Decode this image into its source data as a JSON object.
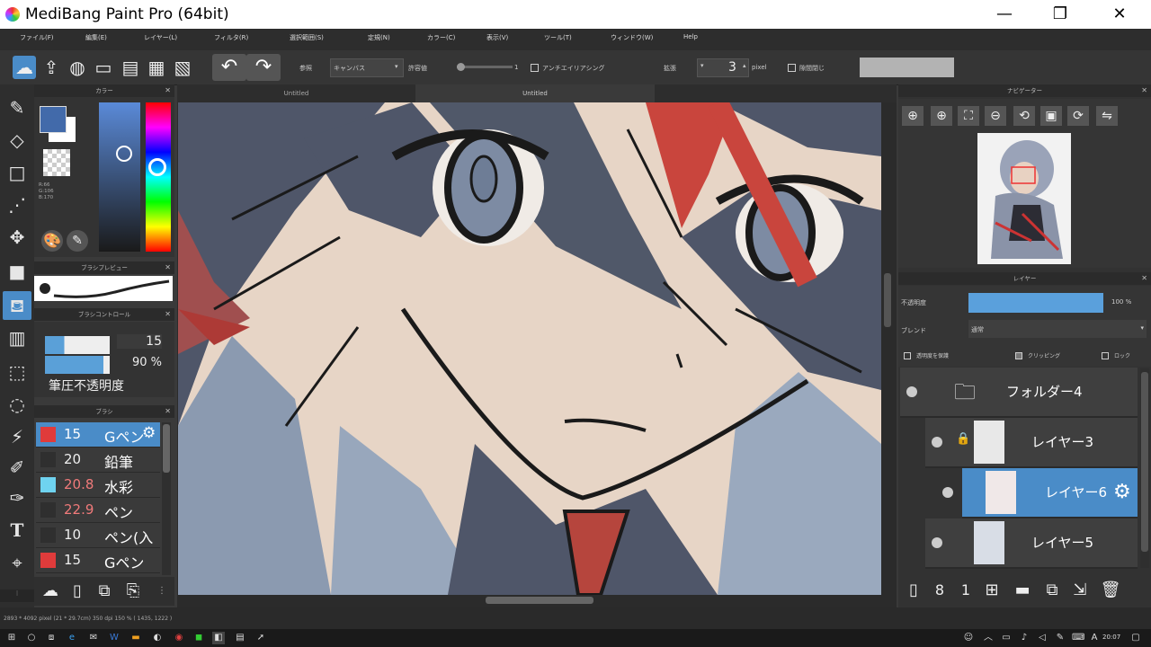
{
  "window": {
    "title": "MediBang Paint Pro (64bit)",
    "minimize": "—",
    "maximize": "❐",
    "close": "✕"
  },
  "menu": [
    "ファイル(F)",
    "編集(E)",
    "レイヤー(L)",
    "フィルタ(R)",
    "選択範囲(S)",
    "定規(N)",
    "カラー(C)",
    "表示(V)",
    "ツール(T)",
    "ウィンドウ(W)",
    "Help"
  ],
  "toolbar": {
    "reference_label": "参照",
    "reference_value": "キャンバス",
    "tolerance_label": "許容値",
    "tolerance_value": "1",
    "antialias_label": "アンチエイリアシング",
    "expand_label": "拡張",
    "expand_value": "3",
    "expand_unit": "pixel",
    "close_gap_label": "隙間閉じ"
  },
  "tabs": [
    "Untitled",
    "Untitled"
  ],
  "color_panel": {
    "title": "カラー",
    "r": "R:66",
    "g": "G:106",
    "b": "B:170",
    "fg_color": "#426aaa"
  },
  "brush_preview_panel": {
    "title": "ブラシプレビュー"
  },
  "brush_control_panel": {
    "title": "ブラシコントロール",
    "size": "15",
    "opacity": "90 %",
    "pressure_label": "筆圧不透明度"
  },
  "brush_panel": {
    "title": "ブラシ",
    "items": [
      {
        "size": "15",
        "name": "Gペン",
        "color": "#e03b3b",
        "selected": true,
        "size_color": "#ffffff"
      },
      {
        "size": "20",
        "name": "鉛筆",
        "color": "#2f2f2f",
        "selected": false,
        "size_color": "#eeeeee"
      },
      {
        "size": "20.8",
        "name": "水彩",
        "color": "#6fd3f0",
        "selected": false,
        "size_color": "#f07a7a"
      },
      {
        "size": "22.9",
        "name": "ペン",
        "color": "#2f2f2f",
        "selected": false,
        "size_color": "#f07a7a"
      },
      {
        "size": "10",
        "name": "ペン(入り",
        "color": "#2f2f2f",
        "selected": false,
        "size_color": "#eeeeee"
      },
      {
        "size": "15",
        "name": "Gペン",
        "color": "#e03b3b",
        "selected": false,
        "size_color": "#eeeeee"
      }
    ]
  },
  "navigator_panel": {
    "title": "ナビゲーター"
  },
  "layer_panel": {
    "title": "レイヤー",
    "opacity_label": "不透明度",
    "opacity_value": "100 %",
    "opacity_fraction": 1.0,
    "blend_label": "ブレンド",
    "blend_value": "通常",
    "protect_alpha_label": "透明度を保護",
    "clipping_label": "クリッピング",
    "lock_label": "ロック",
    "layers": [
      {
        "name": "フォルダー4",
        "type": "folder",
        "selected": false
      },
      {
        "name": "レイヤー3",
        "type": "layer",
        "selected": false,
        "locked": true
      },
      {
        "name": "レイヤー6",
        "type": "layer",
        "selected": true
      },
      {
        "name": "レイヤー5",
        "type": "layer",
        "selected": false
      }
    ]
  },
  "status_bar": {
    "info": "2893 * 4092 pixel  (21 * 29.7cm)  350 dpi  150 %  ( 1435, 1222 )"
  },
  "taskbar": {
    "time": "20:07"
  }
}
